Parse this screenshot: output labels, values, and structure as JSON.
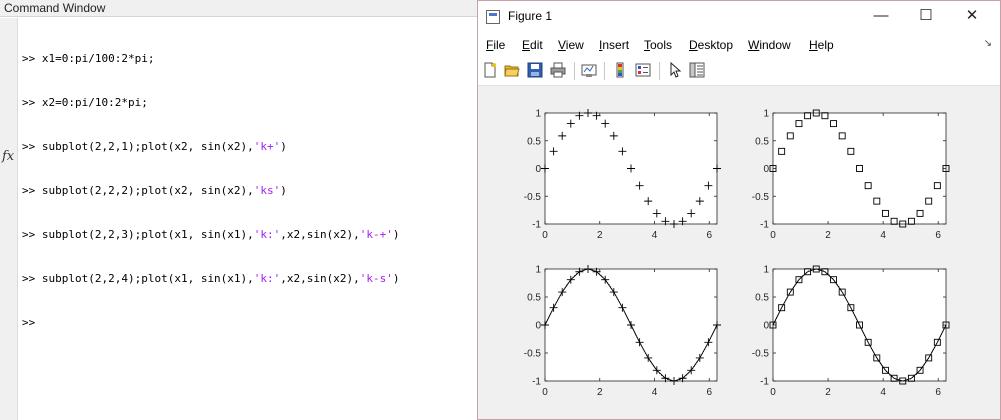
{
  "command_window": {
    "title": "Command Window",
    "fx_symbol": "fx",
    "prompt": ">>",
    "lines": [
      {
        "code": "x1=0:pi/100:2*pi;"
      },
      {
        "code": "x2=0:pi/10:2*pi;"
      },
      {
        "pre": "subplot(2,2,1);plot(x2, sin(x2),",
        "s1": "'k+'",
        "post": ")"
      },
      {
        "pre": "subplot(2,2,2);plot(x2, sin(x2),",
        "s1": "'ks'",
        "post": ")"
      },
      {
        "pre": "subplot(2,2,3);plot(x1, sin(x1),",
        "s1": "'k:'",
        "mid": ",x2,sin(x2),",
        "s2": "'k-+'",
        "post": ")"
      },
      {
        "pre": "subplot(2,2,4);plot(x1, sin(x1),",
        "s1": "'k:'",
        "mid": ",x2,sin(x2),",
        "s2": "'k-s'",
        "post": ")"
      }
    ]
  },
  "figure": {
    "title": "Figure 1",
    "window_buttons": {
      "minimize": "—",
      "maximize": "☐",
      "close": "✕"
    },
    "menu": [
      {
        "u": "F",
        "rest": "ile"
      },
      {
        "u": "E",
        "rest": "dit"
      },
      {
        "u": "V",
        "rest": "iew"
      },
      {
        "u": "I",
        "rest": "nsert"
      },
      {
        "u": "T",
        "rest": "ools"
      },
      {
        "u": "D",
        "rest": "esktop"
      },
      {
        "u": "W",
        "rest": "indow"
      },
      {
        "u": "H",
        "rest": "elp"
      }
    ],
    "menu_overflow_icon": "arrow-icon",
    "toolbar_icons": [
      "new-figure-icon",
      "open-file-icon",
      "save-icon",
      "print-icon",
      "link-plot-icon",
      "colorbar-icon",
      "legend-icon",
      "pointer-icon",
      "property-inspector-icon"
    ]
  },
  "chart_data": [
    {
      "type": "scatter",
      "title": "",
      "xlabel": "",
      "ylabel": "",
      "xlim": [
        0,
        6.2832
      ],
      "ylim": [
        -1,
        1
      ],
      "xticks": [
        0,
        2,
        4,
        6
      ],
      "yticks": [
        -1,
        -0.5,
        0,
        0.5,
        1
      ],
      "xtick_labels": [
        "0",
        "2",
        "4",
        "6"
      ],
      "ytick_labels": [
        "-1",
        "-0.5",
        "0",
        "0.5",
        "1"
      ],
      "grid": false,
      "series": [
        {
          "function": "sin",
          "x_start": 0,
          "x_step": 0.31416,
          "x_end": 6.2832,
          "marker": "plus",
          "line": "none",
          "color": "#000000"
        }
      ]
    },
    {
      "type": "scatter",
      "title": "",
      "xlabel": "",
      "ylabel": "",
      "xlim": [
        0,
        6.2832
      ],
      "ylim": [
        -1,
        1
      ],
      "xticks": [
        0,
        2,
        4,
        6
      ],
      "yticks": [
        -1,
        -0.5,
        0,
        0.5,
        1
      ],
      "xtick_labels": [
        "0",
        "2",
        "4",
        "6"
      ],
      "ytick_labels": [
        "-1",
        "-0.5",
        "0",
        "0.5",
        "1"
      ],
      "grid": false,
      "series": [
        {
          "function": "sin",
          "x_start": 0,
          "x_step": 0.31416,
          "x_end": 6.2832,
          "marker": "square",
          "line": "none",
          "color": "#000000"
        }
      ]
    },
    {
      "type": "line",
      "title": "",
      "xlabel": "",
      "ylabel": "",
      "xlim": [
        0,
        6.2832
      ],
      "ylim": [
        -1,
        1
      ],
      "xticks": [
        0,
        2,
        4,
        6
      ],
      "yticks": [
        -1,
        -0.5,
        0,
        0.5,
        1
      ],
      "xtick_labels": [
        "0",
        "2",
        "4",
        "6"
      ],
      "ytick_labels": [
        "-1",
        "-0.5",
        "0",
        "0.5",
        "1"
      ],
      "grid": false,
      "series": [
        {
          "function": "sin",
          "x_start": 0,
          "x_step": 0.031416,
          "x_end": 6.2832,
          "marker": "none",
          "line": "dotted",
          "color": "#000000"
        },
        {
          "function": "sin",
          "x_start": 0,
          "x_step": 0.31416,
          "x_end": 6.2832,
          "marker": "plus",
          "line": "solid",
          "color": "#000000"
        }
      ]
    },
    {
      "type": "line",
      "title": "",
      "xlabel": "",
      "ylabel": "",
      "xlim": [
        0,
        6.2832
      ],
      "ylim": [
        -1,
        1
      ],
      "xticks": [
        0,
        2,
        4,
        6
      ],
      "yticks": [
        -1,
        -0.5,
        0,
        0.5,
        1
      ],
      "xtick_labels": [
        "0",
        "2",
        "4",
        "6"
      ],
      "ytick_labels": [
        "-1",
        "-0.5",
        "0",
        "0.5",
        "1"
      ],
      "grid": false,
      "series": [
        {
          "function": "sin",
          "x_start": 0,
          "x_step": 0.031416,
          "x_end": 6.2832,
          "marker": "none",
          "line": "dotted",
          "color": "#000000"
        },
        {
          "function": "sin",
          "x_start": 0,
          "x_step": 0.31416,
          "x_end": 6.2832,
          "marker": "square",
          "line": "solid",
          "color": "#000000"
        }
      ]
    }
  ]
}
